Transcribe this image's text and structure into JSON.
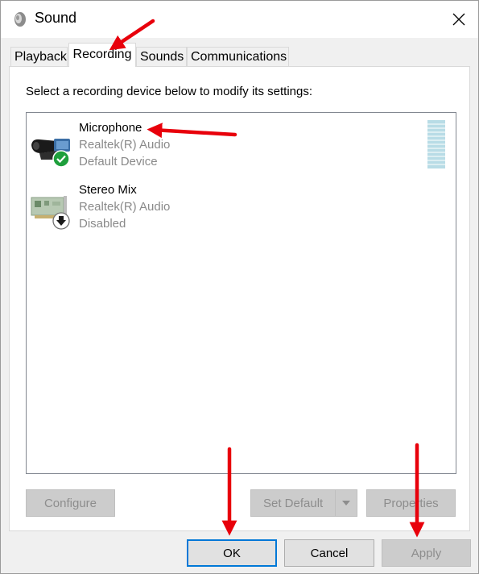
{
  "window": {
    "title": "Sound"
  },
  "tabs": [
    {
      "label": "Playback",
      "active": false
    },
    {
      "label": "Recording",
      "active": true
    },
    {
      "label": "Sounds",
      "active": false
    },
    {
      "label": "Communications",
      "active": false
    }
  ],
  "recording": {
    "instruction": "Select a recording device below to modify its settings:",
    "devices": [
      {
        "name": "Microphone",
        "driver": "Realtek(R) Audio",
        "status": "Default Device",
        "icon": "microphone-icon",
        "badge": "check-badge-icon"
      },
      {
        "name": "Stereo Mix",
        "driver": "Realtek(R) Audio",
        "status": "Disabled",
        "icon": "sound-card-icon",
        "badge": "down-arrow-badge-icon"
      }
    ],
    "buttons": {
      "configure": "Configure",
      "set_default": "Set Default",
      "properties": "Properties"
    }
  },
  "dialog_buttons": {
    "ok": "OK",
    "cancel": "Cancel",
    "apply": "Apply"
  },
  "colors": {
    "accent": "#0078d7",
    "annotation": "#e8000b",
    "meter": "#b8dce6",
    "check": "#1e9f3c"
  }
}
